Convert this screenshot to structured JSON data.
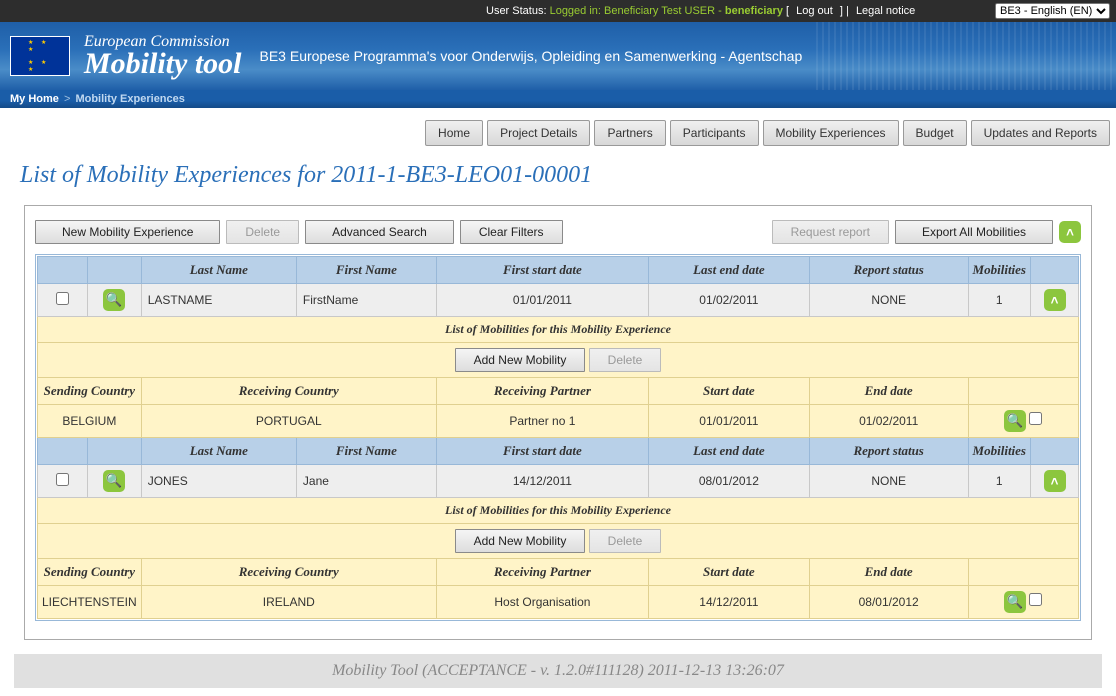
{
  "topbar": {
    "status_prefix": "User Status: ",
    "logged_in": "Logged in: Beneficiary Test USER - ",
    "role": "beneficiary",
    "logout": "Log out",
    "legal": "Legal notice",
    "lang": "BE3 - English (EN)"
  },
  "banner": {
    "ec": "European Commission",
    "tool": "Mobility tool",
    "agency": "BE3 Europese Programma's voor Onderwijs, Opleiding en Samenwerking - Agentschap"
  },
  "breadcrumb": {
    "home": "My Home",
    "current": "Mobility Experiences"
  },
  "nav": {
    "home": "Home",
    "project": "Project Details",
    "partners": "Partners",
    "participants": "Participants",
    "mobexp": "Mobility Experiences",
    "budget": "Budget",
    "updates": "Updates and Reports"
  },
  "page_title": "List of Mobility Experiences for 2011-1-BE3-LEO01-00001",
  "toolbar": {
    "new": "New Mobility Experience",
    "delete": "Delete",
    "advanced": "Advanced Search",
    "clear": "Clear Filters",
    "request": "Request report",
    "export": "Export All Mobilities"
  },
  "headers": {
    "last_name": "Last Name",
    "first_name": "First Name",
    "first_start": "First start date",
    "last_end": "Last end date",
    "report_status": "Report status",
    "mobilities": "Mobilities"
  },
  "sub_title": "List of Mobilities for this Mobility Experience",
  "sub_buttons": {
    "add": "Add New Mobility",
    "delete": "Delete"
  },
  "sub_headers": {
    "sending": "Sending Country",
    "receiving": "Receiving Country",
    "partner": "Receiving Partner",
    "start": "Start date",
    "end": "End date"
  },
  "rows": [
    {
      "last_name": "LASTNAME",
      "first_name": "FirstName",
      "first_start": "01/01/2011",
      "last_end": "01/02/2011",
      "report_status": "NONE",
      "mobilities": "1",
      "sub": [
        {
          "sending": "BELGIUM",
          "receiving": "PORTUGAL",
          "partner": "Partner no 1",
          "start": "01/01/2011",
          "end": "01/02/2011"
        }
      ]
    },
    {
      "last_name": "JONES",
      "first_name": "Jane",
      "first_start": "14/12/2011",
      "last_end": "08/01/2012",
      "report_status": "NONE",
      "mobilities": "1",
      "sub": [
        {
          "sending": "LIECHTENSTEIN",
          "receiving": "IRELAND",
          "partner": "Host Organisation",
          "start": "14/12/2011",
          "end": "08/01/2012"
        }
      ]
    }
  ],
  "footer": "Mobility Tool (ACCEPTANCE - v. 1.2.0#111128) 2011-12-13 13:26:07"
}
